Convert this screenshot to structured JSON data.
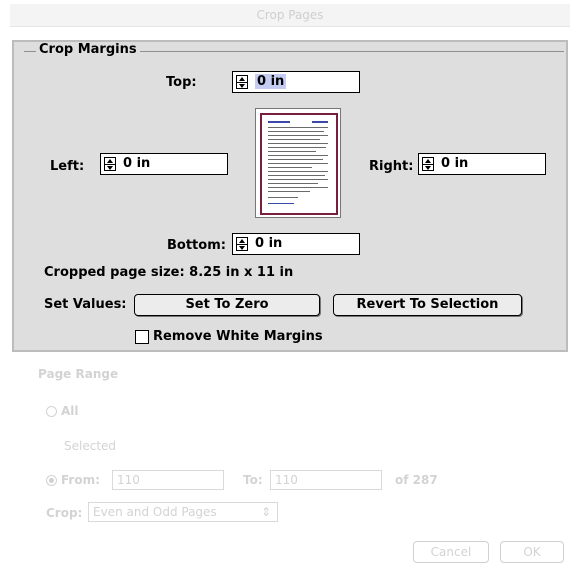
{
  "window": {
    "title": "Crop Pages"
  },
  "crop_margins": {
    "title": "Crop Margins",
    "top": {
      "label": "Top:",
      "value": "0 in"
    },
    "left": {
      "label": "Left:",
      "value": "0 in"
    },
    "right": {
      "label": "Right:",
      "value": "0 in"
    },
    "bottom": {
      "label": "Bottom:",
      "value": "0 in"
    },
    "cropped_size": "Cropped page size: 8.25 in x 11 in",
    "set_values_label": "Set Values:",
    "set_to_zero": "Set To Zero",
    "revert_to_selection": "Revert To Selection",
    "remove_white_margins": "Remove White Margins"
  },
  "page_range": {
    "title": "Page Range",
    "all_label": "All",
    "selected_label": "Selected",
    "from_label": "From:",
    "from_value": "110",
    "to_label": "To:",
    "to_value": "110",
    "of_label": "of 287",
    "crop_label": "Crop:",
    "crop_option": "Even and Odd Pages"
  },
  "buttons": {
    "cancel": "Cancel",
    "ok": "OK"
  }
}
